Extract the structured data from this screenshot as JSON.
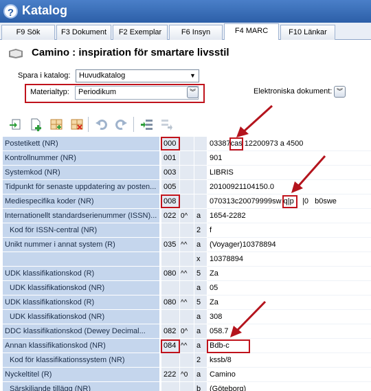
{
  "window": {
    "title": "Katalog",
    "help_label": "?"
  },
  "tabs": [
    {
      "label": "F9 Sök",
      "active": false
    },
    {
      "label": "F3 Dokument",
      "active": false
    },
    {
      "label": "F2 Exemplar",
      "active": false
    },
    {
      "label": "F6 Insyn",
      "active": false
    },
    {
      "label": "F4 MARC",
      "active": true
    },
    {
      "label": "F10 Länkar",
      "active": false
    }
  ],
  "record": {
    "title": "Camino : inspiration för smartare livsstil"
  },
  "form": {
    "spara_label": "Spara i katalog:",
    "spara_value": "Huvudkatalog",
    "materialtyp_label": "Materialtyp:",
    "materialtyp_value": "Periodikum",
    "elektroniska_label": "Elektroniska dokument:"
  },
  "toolbar_icons": [
    "import-icon",
    "new-document-icon",
    "add-field-icon",
    "delete-field-icon",
    "undo-icon",
    "redo-icon",
    "move-field-icon",
    "disabled-action-icon"
  ],
  "marc_rows": [
    {
      "name": "Postetikett (NR)",
      "tag": "000",
      "ind": "",
      "sub": "",
      "value": "03387cas 12200973 a 4500",
      "sub_row": false
    },
    {
      "name": "Kontrollnummer (NR)",
      "tag": "001",
      "ind": "",
      "sub": "",
      "value": "901",
      "sub_row": false
    },
    {
      "name": "Systemkod (NR)",
      "tag": "003",
      "ind": "",
      "sub": "",
      "value": "LIBRIS",
      "sub_row": false
    },
    {
      "name": "Tidpunkt för senaste uppdatering av posten...",
      "tag": "005",
      "ind": "",
      "sub": "",
      "value": "20100921104150.0",
      "sub_row": false
    },
    {
      "name": "Mediespecifika koder (NR)",
      "tag": "008",
      "ind": "",
      "sub": "",
      "value": "070313c20079999sw q|p    |0   b0swe",
      "sub_row": false
    },
    {
      "name": "Internationellt standardserienummer (ISSN)...",
      "tag": "022",
      "ind": "0^",
      "sub": "a",
      "value": "1654-2282",
      "sub_row": false
    },
    {
      "name": "Kod för ISSN-central (NR)",
      "tag": "",
      "ind": "",
      "sub": "2",
      "value": "f",
      "sub_row": true
    },
    {
      "name": "Unikt nummer i annat system (R)",
      "tag": "035",
      "ind": "^^",
      "sub": "a",
      "value": "(Voyager)10378894",
      "sub_row": false
    },
    {
      "name": "",
      "tag": "",
      "ind": "",
      "sub": "x",
      "value": "10378894",
      "sub_row": true
    },
    {
      "name": "UDK klassifikationskod (R)",
      "tag": "080",
      "ind": "^^",
      "sub": "5",
      "value": "Za",
      "sub_row": false
    },
    {
      "name": "UDK klassifikationskod (NR)",
      "tag": "",
      "ind": "",
      "sub": "a",
      "value": "05",
      "sub_row": true
    },
    {
      "name": "UDK klassifikationskod (R)",
      "tag": "080",
      "ind": "^^",
      "sub": "5",
      "value": "Za",
      "sub_row": false
    },
    {
      "name": "UDK klassifikationskod (NR)",
      "tag": "",
      "ind": "",
      "sub": "a",
      "value": "308",
      "sub_row": true
    },
    {
      "name": "DDC klassifikationskod (Dewey Decimal...",
      "tag": "082",
      "ind": "0^",
      "sub": "a",
      "value": "058.7",
      "sub_row": false
    },
    {
      "name": "Annan klassifikationskod (NR)",
      "tag": "084",
      "ind": "^^",
      "sub": "a",
      "value": "Bdb-c",
      "sub_row": false
    },
    {
      "name": "Kod för klassifikationssystem (NR)",
      "tag": "",
      "ind": "",
      "sub": "2",
      "value": "kssb/8",
      "sub_row": true
    },
    {
      "name": "Nyckeltitel (R)",
      "tag": "222",
      "ind": "^0",
      "sub": "a",
      "value": "Camino",
      "sub_row": false
    },
    {
      "name": "Särskiljande tillägg (NR)",
      "tag": "",
      "ind": "",
      "sub": "b",
      "value": "(Göteborg)",
      "sub_row": true
    }
  ],
  "colors": {
    "titlebar": "#3a6fba",
    "highlight_red": "#c0121b",
    "field_name_bg": "#c5d6ed"
  }
}
